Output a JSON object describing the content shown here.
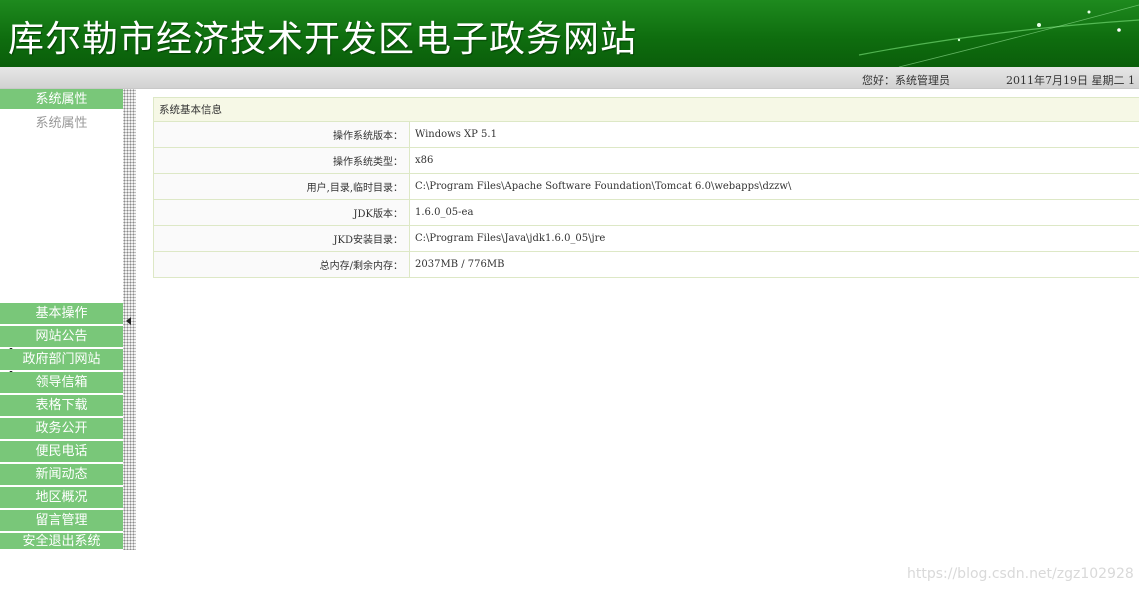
{
  "banner": {
    "title": "库尔勒市经济技术开发区电子政务网站"
  },
  "statusbar": {
    "greeting": "您好：系统管理员",
    "datetime": "2011年7月19日 星期二 1"
  },
  "sidebar": {
    "header": "系统属性",
    "sub_items": [
      "系统属性"
    ],
    "items": [
      {
        "label": "基本操作"
      },
      {
        "label": "网站公告"
      },
      {
        "label": "政府部门网站"
      },
      {
        "label": "领导信箱"
      },
      {
        "label": "表格下载"
      },
      {
        "label": "政务公开"
      },
      {
        "label": "便民电话"
      },
      {
        "label": "新闻动态"
      },
      {
        "label": "地区概况"
      },
      {
        "label": "留言管理"
      },
      {
        "label": "安全退出系统"
      }
    ]
  },
  "info": {
    "title": "系统基本信息",
    "rows": [
      {
        "label": "操作系统版本：",
        "value": "Windows XP  5.1"
      },
      {
        "label": "操作系统类型：",
        "value": "x86"
      },
      {
        "label": "用户,目录,临时目录：",
        "value": "C:\\Program Files\\Apache Software Foundation\\Tomcat 6.0\\webapps\\dzzw\\"
      },
      {
        "label": "JDK版本：",
        "value": "1.6.0_05-ea"
      },
      {
        "label": "JKD安装目录：",
        "value": "C:\\Program Files\\Java\\jdk1.6.0_05\\jre"
      },
      {
        "label": "总内存/剩余内存：",
        "value": "2037MB  /  776MB"
      }
    ]
  },
  "watermark": "https://blog.csdn.net/zgz102928",
  "colors": {
    "banner_green": "#0f6e0f",
    "nav_green": "#79c779",
    "table_border": "#dde8c6"
  }
}
